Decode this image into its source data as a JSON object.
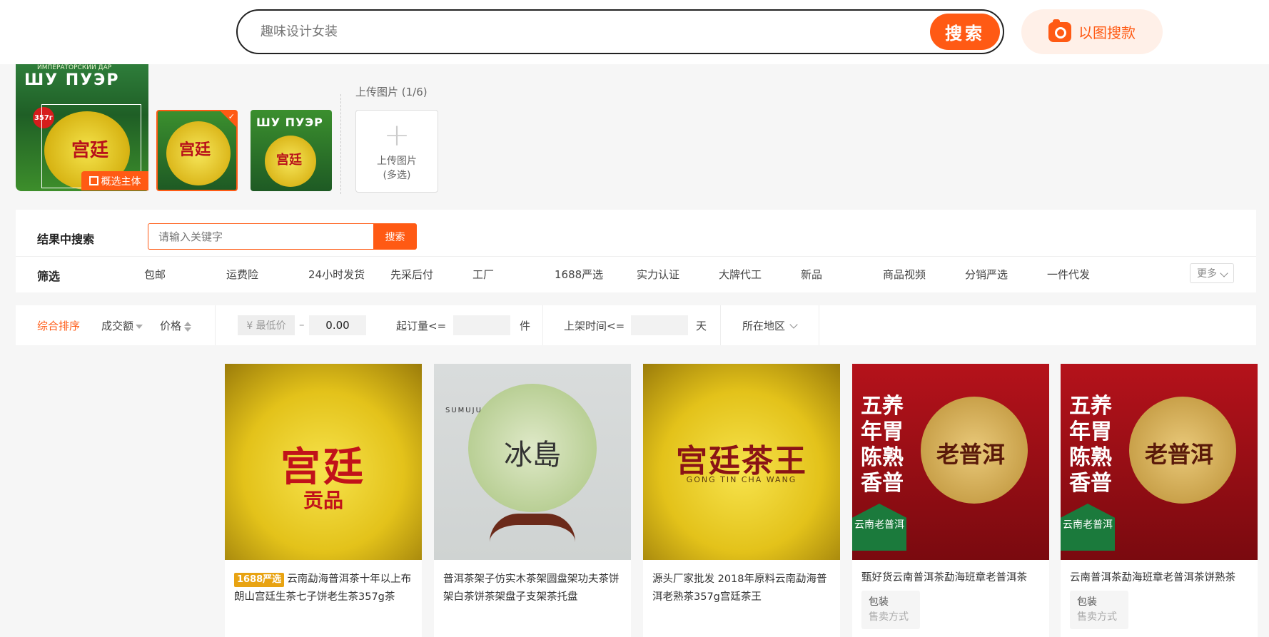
{
  "header": {
    "search_placeholder": "趣味设计女装",
    "search_button": "搜索",
    "image_search_button": "以图搜款"
  },
  "uploads": {
    "main_thumb_top_text": "ШУ ПУЭР",
    "main_thumb_small_text": "ИМПЕРАТОРСКИЙ ДАР",
    "badge": "357г",
    "crop_button": "概选主体",
    "thumb_text_a": "宫廷",
    "thumb_text_b": "ШУ ПУЭР",
    "upload_label": "上传图片 (1/6)",
    "upload_box_line1": "上传图片",
    "upload_box_line2": "(多选)"
  },
  "filters": {
    "search_label": "结果中搜索",
    "keyword_placeholder": "请输入关键字",
    "keyword_button": "搜索",
    "filter_label": "筛选",
    "items": [
      "包邮",
      "运费险",
      "24小时发货",
      "先采后付",
      "工厂",
      "1688严选",
      "实力认证",
      "大牌代工",
      "新品",
      "商品视频",
      "分销严选",
      "一件代发"
    ],
    "more": "更多"
  },
  "sort": {
    "comprehensive": "综合排序",
    "volume": "成交额",
    "price": "价格",
    "price_min_placeholder": "¥ 最低价",
    "dash": "–",
    "price_max": "0.00",
    "moq_label": "起订量<=",
    "moq_unit": "件",
    "listed_label": "上架时间<=",
    "listed_unit": "天",
    "region": "所在地区"
  },
  "products": [
    {
      "tag": "1688严选",
      "title": "云南勐海普洱茶十年以上布朗山宫廷生茶七子饼老生茶357g茶",
      "img_text": "宫廷",
      "img_sub": "贡品"
    },
    {
      "tag": "",
      "title": "普洱茶架子仿实木茶架圆盘架功夫茶饼架白茶饼茶架盘子支架茶托盘",
      "img_text": "冰島",
      "img_sub": "SUMUJU"
    },
    {
      "tag": "",
      "title": "源头厂家批发 2018年原料云南勐海普洱老熟茶357g宫廷茶王",
      "img_text": "宫廷茶王",
      "img_sub": "GONG TIN CHA WANG"
    },
    {
      "tag": "",
      "title": "甄好货云南普洱茶勐海班章老普洱茶",
      "img_text": "老普洱",
      "img_sub": "五养年胃陈熟香普",
      "spec": "包装",
      "spec_sub": "售卖方式",
      "badge": "云南老普洱"
    },
    {
      "tag": "",
      "title": "云南普洱茶勐海班章老普洱茶饼熟茶",
      "img_text": "老普洱",
      "img_sub": "五养年胃陈熟香普",
      "spec": "包装",
      "spec_sub": "售卖方式",
      "badge": "云南老普洱"
    }
  ],
  "colors": {
    "accent": "#ff5a14",
    "tag": "#e8a312"
  }
}
